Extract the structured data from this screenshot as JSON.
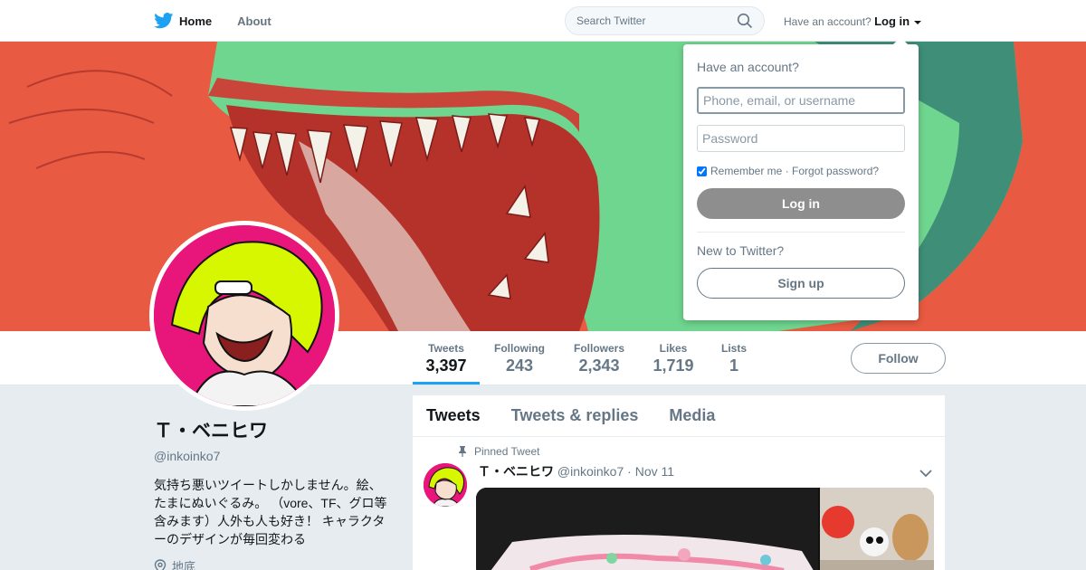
{
  "nav": {
    "home_label": "Home",
    "about_label": "About",
    "search_placeholder": "Search Twitter",
    "have_account_text": "Have an account?",
    "login_label": "Log in"
  },
  "colors": {
    "twitter_blue": "#1da1f2",
    "banner_bg": "#e85a42",
    "avatar_bg": "#e8157a"
  },
  "stats": [
    {
      "label": "Tweets",
      "value": "3,397"
    },
    {
      "label": "Following",
      "value": "243"
    },
    {
      "label": "Followers",
      "value": "2,343"
    },
    {
      "label": "Likes",
      "value": "1,719"
    },
    {
      "label": "Lists",
      "value": "1"
    }
  ],
  "follow_label": "Follow",
  "profile": {
    "name": "Ｔ・ベニヒワ",
    "handle": "@inkoinko7",
    "bio": "気持ち悪いツイートしかしません。絵、たまにぬいぐるみ。 （vore、TF、グロ等含みます）人外も人も好き！ キャラクターのデザインが毎回変わる",
    "location": "地底"
  },
  "timeline": {
    "tabs": [
      "Tweets",
      "Tweets & replies",
      "Media"
    ],
    "pinned_label": "Pinned Tweet",
    "tweet": {
      "name": "Ｔ・ベニヒワ",
      "handle": "@inkoinko7",
      "date": "· Nov 11"
    }
  },
  "login_dropdown": {
    "title": "Have an account?",
    "username_placeholder": "Phone, email, or username",
    "password_placeholder": "Password",
    "remember_text": "Remember me · Forgot password?",
    "login_button": "Log in",
    "new_text": "New to Twitter?",
    "signup_button": "Sign up"
  }
}
